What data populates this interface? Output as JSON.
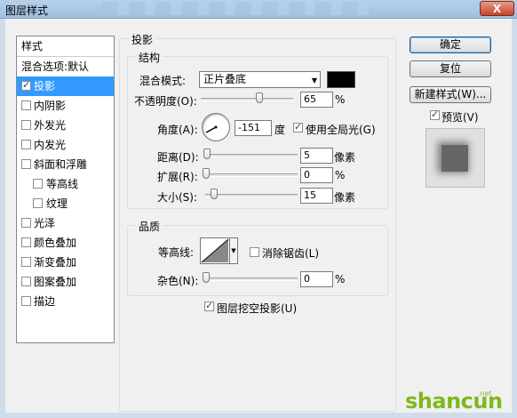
{
  "window": {
    "title": "图层样式",
    "close_glyph": "X"
  },
  "sidebar": {
    "header": "样式",
    "items": [
      {
        "label": "混合选项:默认",
        "checkbox": false
      },
      {
        "label": "投影",
        "checkbox": true,
        "checked": true,
        "selected": true
      },
      {
        "label": "内阴影",
        "checkbox": true,
        "checked": false
      },
      {
        "label": "外发光",
        "checkbox": true,
        "checked": false
      },
      {
        "label": "内发光",
        "checkbox": true,
        "checked": false
      },
      {
        "label": "斜面和浮雕",
        "checkbox": true,
        "checked": false
      },
      {
        "label": "等高线",
        "checkbox": true,
        "checked": false,
        "indent": true
      },
      {
        "label": "纹理",
        "checkbox": true,
        "checked": false,
        "indent": true
      },
      {
        "label": "光泽",
        "checkbox": true,
        "checked": false
      },
      {
        "label": "颜色叠加",
        "checkbox": true,
        "checked": false
      },
      {
        "label": "渐变叠加",
        "checkbox": true,
        "checked": false
      },
      {
        "label": "图案叠加",
        "checkbox": true,
        "checked": false
      },
      {
        "label": "描边",
        "checkbox": true,
        "checked": false
      }
    ]
  },
  "drop_shadow": {
    "title": "投影",
    "structure": {
      "title": "结构",
      "blend_mode_label": "混合模式:",
      "blend_mode_value": "正片叠底",
      "shadow_color": "#000000",
      "opacity_label": "不透明度(O):",
      "opacity_value": "65",
      "opacity_unit": "%",
      "opacity_level": 0.65,
      "angle_label": "角度(A):",
      "angle_value": "-151",
      "angle_unit": "度",
      "global_light_label": "使用全局光(G)",
      "global_light_checked": true,
      "distance_label": "距离(D):",
      "distance_value": "5",
      "distance_unit": "像素",
      "spread_label": "扩展(R):",
      "spread_value": "0",
      "spread_unit": "%",
      "size_label": "大小(S):",
      "size_value": "15",
      "size_unit": "像素"
    },
    "quality": {
      "title": "品质",
      "contour_label": "等高线:",
      "antialias_label": "消除锯齿(L)",
      "antialias_checked": false,
      "noise_label": "杂色(N):",
      "noise_value": "0",
      "noise_unit": "%"
    },
    "knockout_label": "图层挖空投影(U)",
    "knockout_checked": true
  },
  "buttons": {
    "ok": "确定",
    "reset": "复位",
    "new_style": "新建样式(W)...",
    "preview_label": "预览(V)",
    "preview_checked": true
  },
  "watermark": {
    "text": "shancun",
    "sub": ".net"
  }
}
